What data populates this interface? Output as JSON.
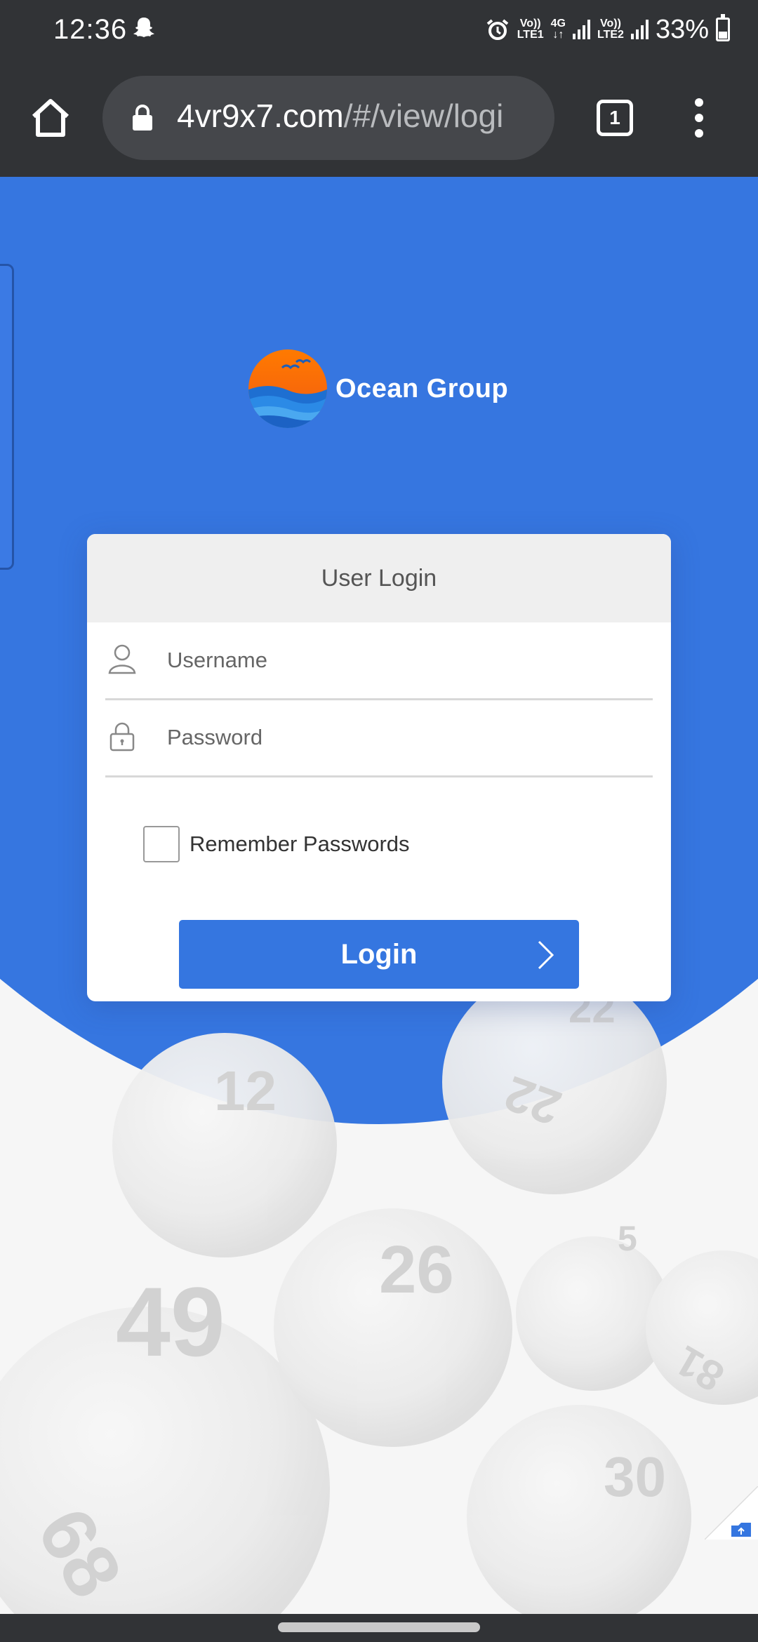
{
  "status_bar": {
    "time": "12:36",
    "battery": "33%",
    "sim1_top": "Vo))",
    "sim1_bottom": "LTE1",
    "net_type": "4G",
    "sim2_top": "Vo))",
    "sim2_bottom": "LTE2"
  },
  "browser": {
    "url_domain": "4vr9x7.com",
    "url_path": "/#/view/logi",
    "tab_count": "1"
  },
  "brand": {
    "name": "Ocean Group"
  },
  "login_form": {
    "title": "User Login",
    "username_placeholder": "Username",
    "password_placeholder": "Password",
    "remember_label": "Remember Passwords",
    "submit_label": "Login"
  },
  "background_balls": [
    "12",
    "22",
    "49",
    "26",
    "5",
    "30",
    "68",
    "22",
    "81"
  ],
  "colors": {
    "accent": "#3576e0",
    "header_bg": "#313336",
    "card_header": "#efefef"
  }
}
